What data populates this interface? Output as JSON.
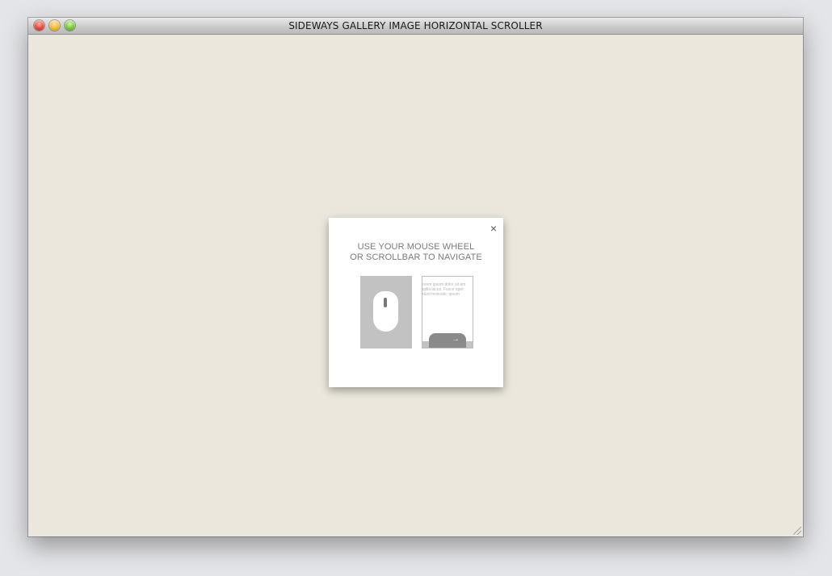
{
  "window": {
    "title": "SIDEWAYS GALLERY IMAGE HORIZONTAL SCROLLER"
  },
  "modal": {
    "close_label": "×",
    "instruction_line1": "USE YOUR MOUSE WHEEL",
    "instruction_line2": "OR SCROLLBAR TO NAVIGATE",
    "page_preview_lines": [
      "orem ipsum dolor sit am",
      "igilla lacus. Fusce eget",
      "dunt molestie, ipsum"
    ],
    "scroll_arrow": "→",
    "icons": [
      "mouse-icon",
      "scrollbar-page-icon"
    ]
  },
  "colors": {
    "background": "#ebe7dd",
    "modal_bg": "#ffffff",
    "illustration_gray": "#c2c2c2"
  }
}
